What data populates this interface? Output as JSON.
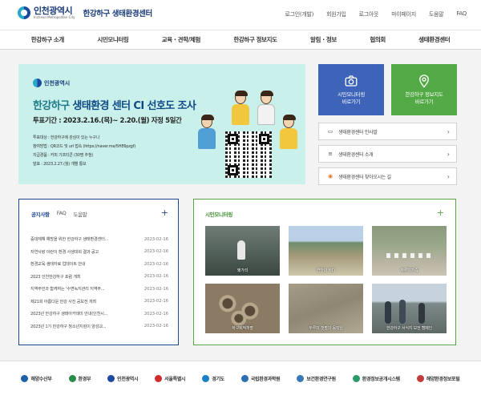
{
  "header": {
    "logo_text": "인천광역시",
    "logo_subtext": "Incheon Metropolitan City",
    "site_title": "한강하구 생태환경센터",
    "util_links": [
      "로그인(개발)",
      "회원가입",
      "로그아웃",
      "마이페이지",
      "도움말",
      "FAQ"
    ]
  },
  "gnb": [
    "한강하구 소개",
    "시민모니터링",
    "교육 · 견학/체험",
    "한강하구 정보지도",
    "알림 · 정보",
    "협의회",
    "생태환경센터"
  ],
  "banner": {
    "logo_text": "인천광역시",
    "headline_part1": "한강하구 ",
    "headline_part2": "생태환경 센터 CI 선호도 조사",
    "period": "투표기간 : 2023.2.16.(목)~ 2.20.(월) 자정 5일간",
    "details": [
      "투표대상 : 한강하구에 관심이 있는 누구나",
      "참여방법 : QR코드 및 url 접속 (https://naver.me/5HE6pzgf)",
      "지급경품 : 커피 기프티콘 (30명 추첨)",
      "발표 : 2023.2.27.(월) 개별 통보"
    ]
  },
  "quick_links": [
    {
      "label": "시민모니터링\n바로가기",
      "icon": "camera-icon"
    },
    {
      "label": "한강하구 정보지도\n바로가기",
      "icon": "map-pin-icon"
    }
  ],
  "link_buttons": [
    {
      "label": "생태환경센터 인사말",
      "icon": "document-icon"
    },
    {
      "label": "생태환경센터 소개",
      "icon": "list-icon"
    },
    {
      "label": "생태환경센터 찾아오시는 길",
      "icon": "location-icon"
    }
  ],
  "notice": {
    "tabs": [
      "공지사항",
      "FAQ",
      "도움말"
    ],
    "more": "+",
    "items": [
      {
        "title": "중대재해 예방을 위한 한강하구 생태환경센터...",
        "date": "2023-02-16"
      },
      {
        "title": "자연사랑 이런이 환경 사생대회 결과 공고",
        "date": "2023-02-16"
      },
      {
        "title": "환경교육 생태자료 업데이트 안내",
        "date": "2023-02-16"
      },
      {
        "title": "2023 인천한강하구 포럼 개최",
        "date": "2023-02-16"
      },
      {
        "title": "지역주민과 함께하는 '수변녹지관리 지역주...",
        "date": "2023-02-16"
      },
      {
        "title": "제21회 아름다운 한강 사진 공모전 개최",
        "date": "2023-02-16"
      },
      {
        "title": "2023년 한강하구 생태아카데미 안내(인천시...",
        "date": "2023-02-16"
      },
      {
        "title": "2023년 1기 한강하구 청소년지킴이 양성교...",
        "date": "2023-02-16"
      }
    ]
  },
  "monitoring": {
    "title": "시민모니터링",
    "more": "+",
    "items": [
      {
        "caption": "왜가리"
      },
      {
        "caption": "연안의 바다"
      },
      {
        "caption": "두루미가족"
      },
      {
        "caption": "하구퇴적개펄"
      },
      {
        "caption": "두루미 갯펄의 움직임"
      },
      {
        "caption": "한강하구 서식지 보전 캠페인"
      }
    ]
  },
  "footer": [
    {
      "name": "해양수산부",
      "color": "#1f5fa8"
    },
    {
      "name": "환경부",
      "color": "#2a8c4a"
    },
    {
      "name": "인천광역시",
      "color": "#1b4aa0"
    },
    {
      "name": "서울특별시",
      "color": "#d12c2c"
    },
    {
      "name": "경기도",
      "color": "#1a7fc4"
    },
    {
      "name": "국립환경과학원",
      "color": "#2c6db4"
    },
    {
      "name": "보건환경연구원",
      "color": "#3a78b8"
    },
    {
      "name": "환경정보공개시스템",
      "color": "#2a9a6b"
    },
    {
      "name": "해양환경정보포털",
      "color": "#c43b3b"
    }
  ]
}
